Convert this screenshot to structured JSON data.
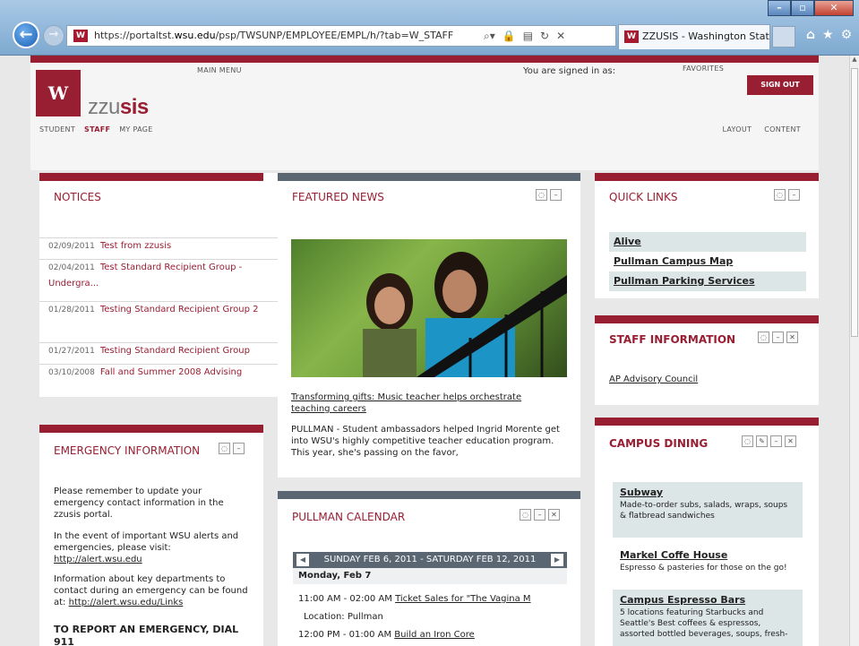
{
  "browser": {
    "url_prefix": "https://portaltst.",
    "url_domain": "wsu.edu",
    "url_rest": "/psp/TWSUNP/EMPLOYEE/EMPL/h/?tab=W_STAFF",
    "tab_title": "ZZUSIS - Washington State ...",
    "icons": [
      "back-icon",
      "forward-icon",
      "search-icon",
      "lock-icon",
      "compat-icon",
      "refresh-icon",
      "stop-icon",
      "home-icon",
      "star-icon",
      "gear-icon"
    ]
  },
  "header": {
    "logo_letter": "W",
    "brand_light": "zzu",
    "brand_bold": "sis",
    "main_menu": "MAIN MENU",
    "signed_in": "You are signed in as:",
    "favorites": "FAVORITES",
    "sign_out": "SIGN OUT",
    "nav": [
      "STUDENT",
      "STAFF",
      "MY PAGE"
    ],
    "nav_right": [
      "LAYOUT",
      "CONTENT"
    ]
  },
  "notices": {
    "title": "NOTICES",
    "items": [
      {
        "date": "02/09/2011",
        "text": "Test from zzusis"
      },
      {
        "date": "02/04/2011",
        "text": "Test Standard Recipient Group - Undergra..."
      },
      {
        "date": "01/28/2011",
        "text": "Testing Standard Recipient Group 2"
      },
      {
        "date": "01/27/2011",
        "text": "Testing Standard Recipient Group"
      },
      {
        "date": "03/10/2008",
        "text": "Fall and Summer 2008 Advising"
      }
    ]
  },
  "emergency": {
    "title": "EMERGENCY INFORMATION",
    "p1": "Please remember to update your emergency contact information in the zzusis portal.",
    "p2": "In the event of important WSU alerts and emergencies, please visit:",
    "p2_link": "http://alert.wsu.edu",
    "p3": "Information about key departments to contact during an emergency can be found at:",
    "p3_link": "http://alert.wsu.edu/Links",
    "p4": "TO REPORT AN EMERGENCY, DIAL 911"
  },
  "featured": {
    "title": "FEATURED NEWS",
    "link": "Transforming gifts: Music teacher helps orchestrate teaching careers",
    "text": "PULLMAN - Student ambassadors helped Ingrid Morente get into WSU's highly competitive teacher education program. This year, she's passing on the favor,"
  },
  "calendar": {
    "title": "PULLMAN CALENDAR",
    "range": "SUNDAY FEB 6, 2011 - SATURDAY FEB 12, 2011",
    "day": "Monday, Feb 7",
    "e1_time": "11:00 AM - 02:00 AM",
    "e1_title": "Ticket Sales for \"The Vagina M",
    "e1_loc": "Location: Pullman",
    "e2_time": "12:00 PM - 01:00 AM",
    "e2_title": "Build an Iron Core"
  },
  "quicklinks": {
    "title": "QUICK LINKS",
    "items": [
      "Alive",
      "Pullman Campus Map",
      "Pullman Parking Services"
    ]
  },
  "staffinfo": {
    "title": "STAFF INFORMATION",
    "link": "AP Advisory Council"
  },
  "dining": {
    "title": "CAMPUS DINING",
    "items": [
      {
        "name": "Subway",
        "desc": "Made-to-order subs, salads, wraps, soups & flatbread sandwiches"
      },
      {
        "name": "Markel Coffe House",
        "desc": "Espresso & pasteries for those on the go!"
      },
      {
        "name": "Campus Espresso Bars",
        "desc": "5 locations featuring Starbucks and Seattle's Best coffees & espressos, assorted bottled beverages, soups, fresh-"
      }
    ]
  },
  "colors": {
    "crimson": "#981e32",
    "slate": "#5a6672",
    "mint": "#dce6e6"
  }
}
